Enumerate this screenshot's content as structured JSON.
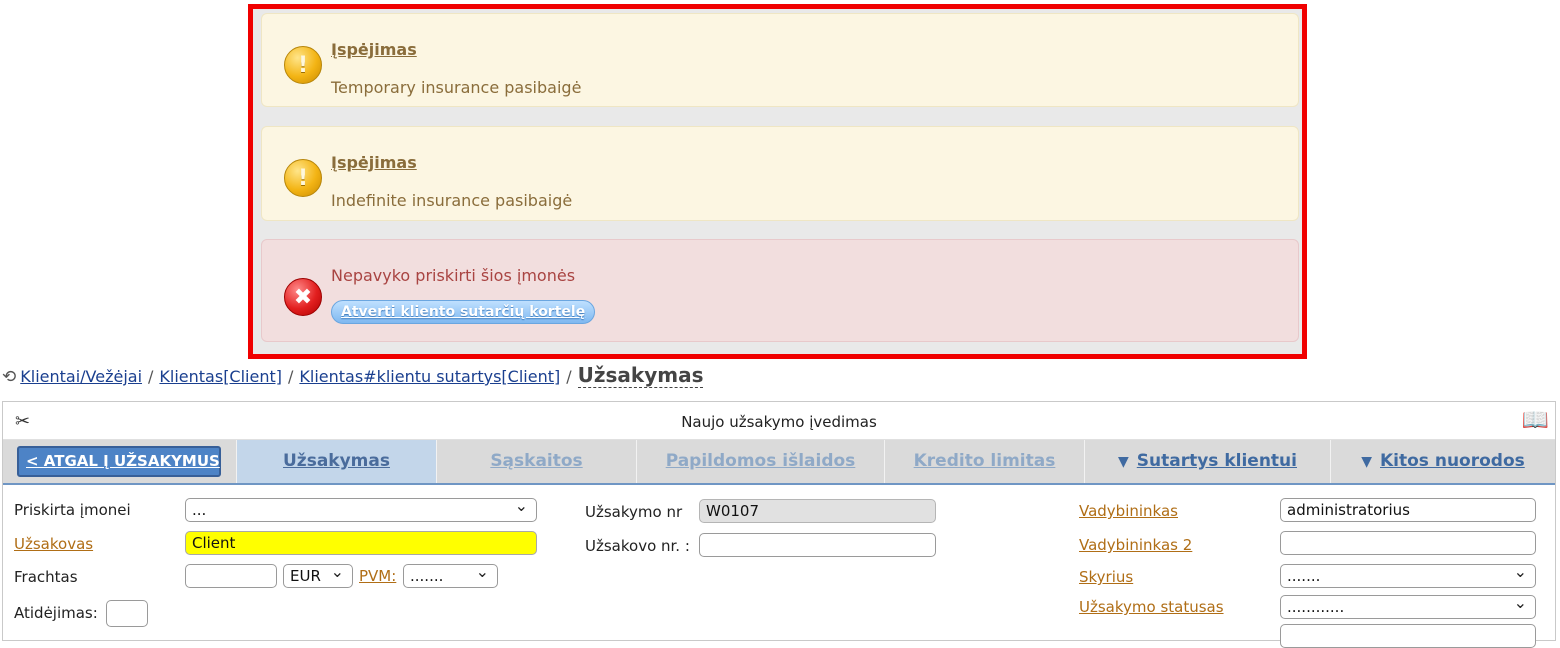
{
  "alerts": [
    {
      "type": "warning",
      "icon": "warning-icon",
      "title": "Įspėjimas",
      "message": "Temporary insurance pasibaigė"
    },
    {
      "type": "warning",
      "icon": "warning-icon",
      "title": "Įspėjimas",
      "message": "Indefinite insurance pasibaigė"
    },
    {
      "type": "error",
      "icon": "error-icon",
      "message": "Nepavyko priskirti šios įmonės",
      "button_label": "Atverti kliento sutarčių kortelę"
    }
  ],
  "breadcrumb": {
    "history_icon": "history-icon",
    "items": [
      "Klientai/Vežėjai",
      "Klientas[Client]",
      "Klientas#klientu sutartys[Client]"
    ],
    "current": "Užsakymas"
  },
  "panel": {
    "title": "Naujo užsakymo įvedimas",
    "tool_icon": "tools-icon",
    "book_icon": "book-view-icon"
  },
  "tabs": {
    "back_label": "< ATGAL Į UŽSAKYMUS",
    "items": [
      "Užsakymas",
      "Sąskaitos",
      "Papildomos išlaidos",
      "Kredito limitas",
      "Sutartys klientui",
      "Kitos nuorodos"
    ],
    "active": "Užsakymas"
  },
  "form": {
    "priskirta_label": "Priskirta įmonei",
    "priskirta_value": "...",
    "uzsakovas_label": "Užsakovas",
    "uzsakovas_value": "Client",
    "frachtas_label": "Frachtas",
    "frachtas_value": "",
    "currency_value": "EUR",
    "pvm_label": "PVM:",
    "pvm_value": ".......",
    "atidejimas_label": "Atidėjimas:",
    "atidejimas_value": "",
    "uzsakymo_nr_label": "Užsakymo nr",
    "uzsakymo_nr_value": "W0107",
    "uzsakovo_nr_label": "Užsakovo nr. :",
    "uzsakovo_nr_value": "",
    "vadybininkas_label": "Vadybininkas",
    "vadybininkas_value": "administratorius",
    "vadybininkas2_label": "Vadybininkas 2",
    "vadybininkas2_value": "",
    "skyrius_label": "Skyrius",
    "skyrius_value": ".......",
    "statusas_label": "Užsakymo statusas",
    "statusas_value": "............"
  },
  "colors": {
    "highlight_border": "#f00000",
    "warning_bg": "#fcf6e2",
    "error_bg": "#f2dede",
    "active_tab": "#c3d6ea",
    "back_button": "#4d83c6",
    "client_field": "#ffff00"
  }
}
